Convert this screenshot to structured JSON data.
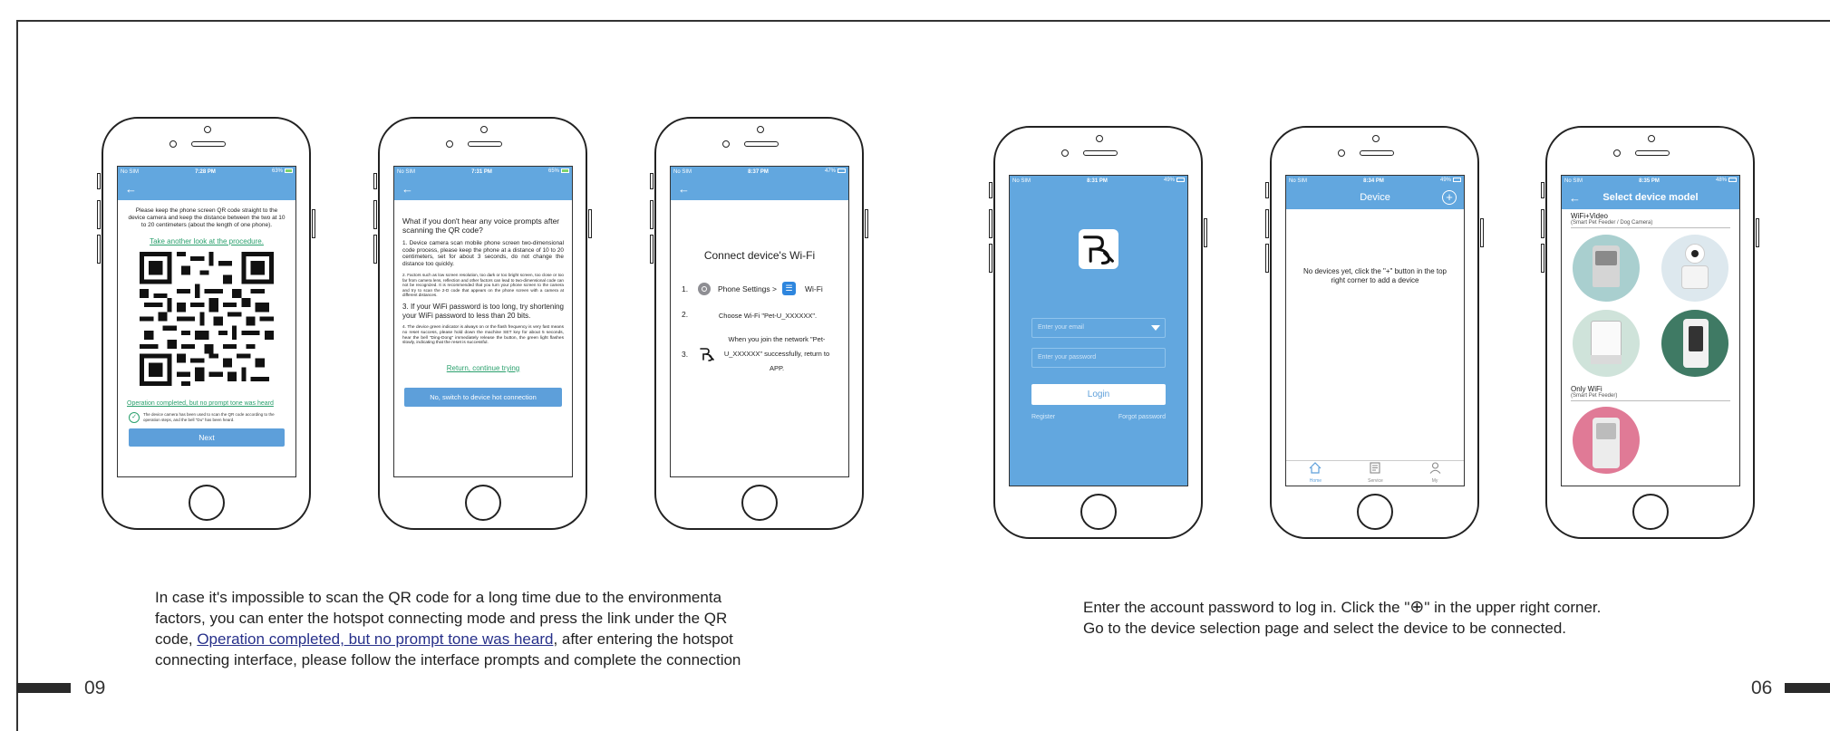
{
  "page": {
    "left_number": "09",
    "right_number": "06"
  },
  "phone1": {
    "status": {
      "carrier": "No SIM",
      "time": "7:28 PM",
      "battery": "63%"
    },
    "instruction": "Please keep the phone screen QR code straight to the device camera and keep the distance between the two at 10 to 20 centimeters (about the length of one phone).",
    "review_link": "Take another look at the procedure.",
    "no_tone_link": "Operation completed, but no prompt tone was heard",
    "check_note": "The device camera has been used to scan the QR code according to the operation steps, and the bell \"Du\" has been heard.",
    "next_button": "Next"
  },
  "phone2": {
    "status": {
      "carrier": "No SIM",
      "time": "7:31 PM",
      "battery": "65%"
    },
    "question": "What if you don't hear any voice prompts after scanning the QR code?",
    "tip1": "1. Device camera scan mobile phone screen two-dimensional code process, please keep the phone at a distance of 10 to 20 centimeters, set for about 3 seconds, do not change the distance too quickly.",
    "tip2": "2. Factors such as low screen resolution, too dark or too bright screen, too close or too far from camera lens, reflection and other factors can lead to two-dimensional code can not be recognized. It is recommended that you turn your phone screen to the camera and try to scan the 2-D code that appears on the phone screen with a camera at different distances.",
    "tip3": "3. If your WiFi password is too long, try shortening your WiFi password to less than 20 bits.",
    "tip4": "4. The device green indicator is always on or the flash frequency is very fast means no reset success, please hold down the machine SET key for about 5 seconds, hear the bell \"Ding-Dong\" immediately release the button, the green light flashes slowly, indicating that the reset is successful.",
    "return_link": "Return, continue trying",
    "hotspot_button": "No, switch to device hot connection"
  },
  "phone3": {
    "status": {
      "carrier": "No SIM",
      "time": "8:37 PM",
      "battery": "47%"
    },
    "heading": "Connect device's Wi-Fi",
    "step1_num": "1.",
    "step1_text": "Phone Settings >",
    "step1_wifi": "Wi-Fi",
    "step2_num": "2.",
    "step2_text": "Choose Wi-Fi \"Pet-U_XXXXXX\".",
    "step3_num": "3.",
    "step3_text": "When you join the network \"Pet-U_XXXXXX\" successfully, return to APP."
  },
  "phone4": {
    "status": {
      "carrier": "No SIM",
      "time": "8:31 PM",
      "battery": "49%"
    },
    "email_placeholder": "Enter your email",
    "password_placeholder": "Enter your password",
    "login_button": "Login",
    "register_link": "Register",
    "forgot_link": "Forgot password"
  },
  "phone5": {
    "status": {
      "carrier": "No SIM",
      "time": "8:34 PM",
      "battery": "49%"
    },
    "title": "Device",
    "plus": "+",
    "empty_message": "No devices yet, click the \"+\" button in the top right corner to add a device",
    "tabs": [
      "Home",
      "Service",
      "My"
    ]
  },
  "phone6": {
    "status": {
      "carrier": "No SIM",
      "time": "8:35 PM",
      "battery": "48%"
    },
    "title": "Select device model",
    "group1_title": "WiFi+Video",
    "group1_sub": "(Smart Pet Feeder / Dog Camera)",
    "group2_title": "Only WiFi",
    "group2_sub": "(Smart Pet Feeder)"
  },
  "caption_left": {
    "line1": "In case it's impossible to scan the QR code for a long time due to the environmenta",
    "line2": "factors, you can enter the hotspot connecting mode and press the link under the QR",
    "line3_pre": "code, ",
    "line3_link": "Operation completed, but no prompt tone was heard",
    "line3_post": ", after entering the hotspot",
    "line4": "connecting interface, please follow the interface prompts and complete the connection"
  },
  "caption_right": {
    "line1_pre": "Enter the account password to log in. Click the \"",
    "line1_symbol": "⊕",
    "line1_post": "\" in the upper right corner.",
    "line2": "Go to the device selection page and select the device to be connected."
  }
}
